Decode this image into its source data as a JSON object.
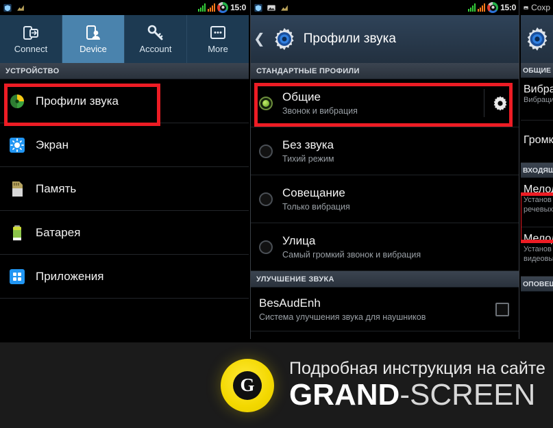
{
  "status_bar": {
    "time": "15:0",
    "left_icons": [
      "shield-icon",
      "signal-chart-icon"
    ],
    "right_icons": [
      "signal-bars-green-icon",
      "signal-bars-orange-icon",
      "battery-ring-icon"
    ],
    "right_panel_label": "Сохр"
  },
  "left_panel": {
    "tabs": [
      {
        "label": "Connect",
        "icon": "connect-icon",
        "active": false
      },
      {
        "label": "Device",
        "icon": "device-person-icon",
        "active": true
      },
      {
        "label": "Account",
        "icon": "key-icon",
        "active": false
      },
      {
        "label": "More",
        "icon": "more-dots-icon",
        "active": false
      }
    ],
    "section_header": "УСТРОЙСТВО",
    "items": [
      {
        "label": "Профили звука",
        "icon": "sound-profiles-icon",
        "highlighted": true
      },
      {
        "label": "Экран",
        "icon": "display-icon",
        "highlighted": false
      },
      {
        "label": "Память",
        "icon": "storage-card-icon",
        "highlighted": false
      },
      {
        "label": "Батарея",
        "icon": "battery-icon",
        "highlighted": false
      },
      {
        "label": "Приложения",
        "icon": "apps-grid-icon",
        "highlighted": false
      }
    ]
  },
  "middle_panel": {
    "title": "Профили звука",
    "title_icon": "settings-gear-icon",
    "back_icon": "back-chevron-icon",
    "sections": [
      {
        "header": "СТАНДАРТНЫЕ ПРОФИЛИ",
        "rows": [
          {
            "title": "Общие",
            "subtitle": "Звонок и вибрация",
            "selected": true,
            "has_gear": true,
            "highlighted": true
          },
          {
            "title": "Без звука",
            "subtitle": "Тихий режим",
            "selected": false,
            "has_gear": false,
            "highlighted": false
          },
          {
            "title": "Совещание",
            "subtitle": "Только вибрация",
            "selected": false,
            "has_gear": false,
            "highlighted": false
          },
          {
            "title": "Улица",
            "subtitle": "Самый громкий звонок и вибрация",
            "selected": false,
            "has_gear": false,
            "highlighted": false
          }
        ]
      },
      {
        "header": "УЛУЧШЕНИЕ ЗВУКА",
        "rows": [
          {
            "title": "BesAudEnh",
            "subtitle": "Система улучшения звука для наушников",
            "checkbox": true,
            "checked": false
          }
        ]
      }
    ]
  },
  "right_panel": {
    "title_icon": "settings-gear-icon",
    "section_1": "ОБЩИЕ",
    "rows_1": [
      {
        "title": "Вибра",
        "subtitle": "Вибраци"
      },
      {
        "title": "Громк",
        "subtitle": ""
      }
    ],
    "section_2": "ВХОДЯЩ",
    "rows_2": [
      {
        "title": "Мелод",
        "subtitle_1": "Установ",
        "subtitle_2": "речевых",
        "highlighted": true
      },
      {
        "title": "Мелод",
        "subtitle_1": "Установ",
        "subtitle_2": "видеовы",
        "highlighted": false
      }
    ],
    "section_3": "ОПОВЕЩ"
  },
  "branding": {
    "logo_letter": "G",
    "line1": "Подробная инструкция на сайте",
    "line2_bold": "GRAND",
    "line2_rest": "-SCREEN"
  },
  "colors": {
    "highlight_red": "#ed1c24",
    "tab_active": "#4a83ad",
    "tab_bar": "#1d3a52",
    "brand_yellow": "#f3d800",
    "section_header": "#3b4450"
  }
}
